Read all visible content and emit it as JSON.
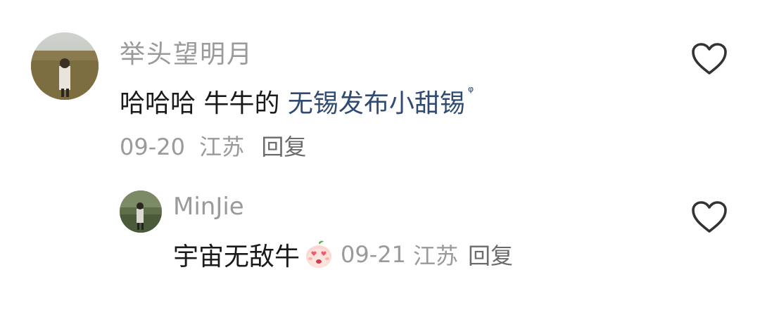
{
  "comments": [
    {
      "username": "举头望明月",
      "text_prefix": "哈哈哈 牛牛的 ",
      "text_link": "无锡发布小甜锡",
      "date": "09-20",
      "location": "江苏",
      "reply_label": "回复"
    },
    {
      "username": "MinJie",
      "text": "宇宙无敌牛",
      "emoji": "heart-eyes-peach-emoji",
      "date": "09-21",
      "location": "江苏",
      "reply_label": "回复"
    }
  ],
  "colors": {
    "username": "#9a9a9a",
    "text": "#1a1a1a",
    "link": "#2f4a73",
    "meta": "#9a9a9a",
    "icon": "#333333"
  }
}
